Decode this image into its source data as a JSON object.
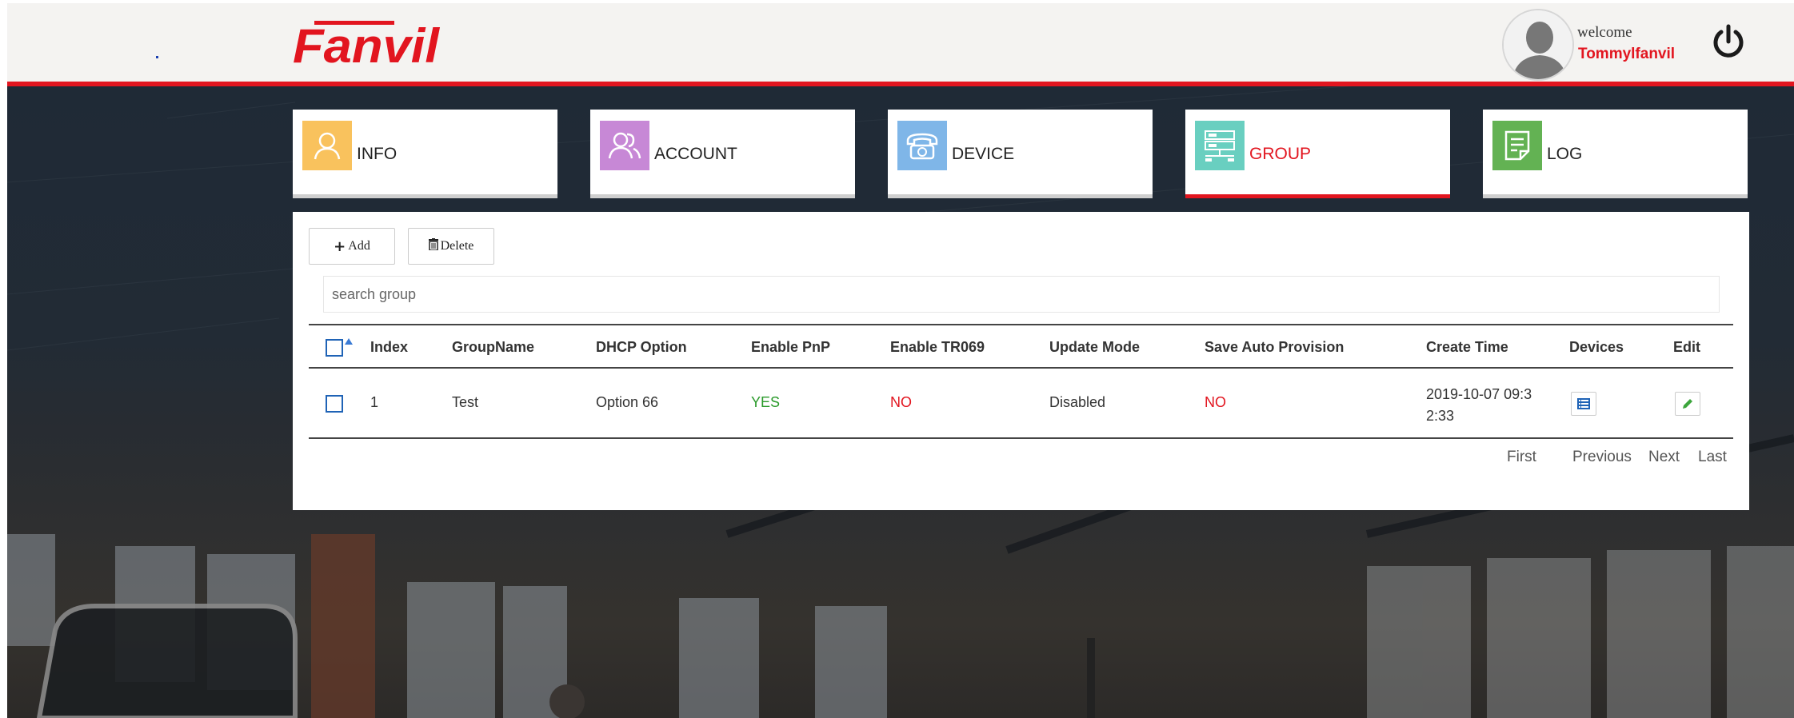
{
  "header": {
    "logo_text": "Fanvil",
    "welcome_label": "welcome",
    "username": "Tommylfanvil"
  },
  "nav": {
    "tiles": [
      {
        "label": "INFO",
        "icon": "user-icon",
        "color": "#f9c25d"
      },
      {
        "label": "ACCOUNT",
        "icon": "users-icon",
        "color": "#c788d6"
      },
      {
        "label": "DEVICE",
        "icon": "telephone-icon",
        "color": "#7fb6e8"
      },
      {
        "label": "GROUP",
        "icon": "server-icon",
        "color": "#69cfc0",
        "active": true
      },
      {
        "label": "LOG",
        "icon": "log-icon",
        "color": "#63b253"
      }
    ]
  },
  "toolbar": {
    "add_label": "Add",
    "delete_label": "Delete"
  },
  "search": {
    "placeholder": "search group"
  },
  "table": {
    "columns": [
      "Index",
      "GroupName",
      "DHCP Option",
      "Enable PnP",
      "Enable TR069",
      "Update Mode",
      "Save Auto Provision",
      "Create Time",
      "Devices",
      "Edit"
    ],
    "rows": [
      {
        "index": "1",
        "group_name": "Test",
        "dhcp_option": "Option 66",
        "enable_pnp": "YES",
        "enable_tr069": "NO",
        "update_mode": "Disabled",
        "save_auto_provision": "NO",
        "create_time_line1": "2019-10-07 09:3",
        "create_time_line2": "2:33"
      }
    ]
  },
  "pagination": {
    "first": "First",
    "previous": "Previous",
    "next": "Next",
    "last": "Last"
  },
  "colors": {
    "brand_red": "#e2151f",
    "yes_green": "#2a9a2a",
    "checkbox_blue": "#1f63b6"
  }
}
